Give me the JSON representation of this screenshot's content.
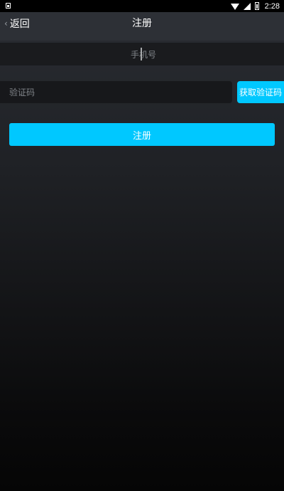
{
  "status_bar": {
    "time": "2:28",
    "icons": [
      "notification-icon",
      "wifi-icon",
      "signal-icon",
      "battery-icon"
    ]
  },
  "header": {
    "back_label": "返回",
    "title": "注册"
  },
  "form": {
    "phone_placeholder": "手机号",
    "phone_value": "",
    "code_placeholder": "验证码",
    "code_value": "",
    "get_code_label": "获取验证码",
    "submit_label": "注册"
  },
  "colors": {
    "accent": "#00C8FF",
    "header_bg": "#2D3036",
    "field_bg": "#1A1B1E"
  }
}
